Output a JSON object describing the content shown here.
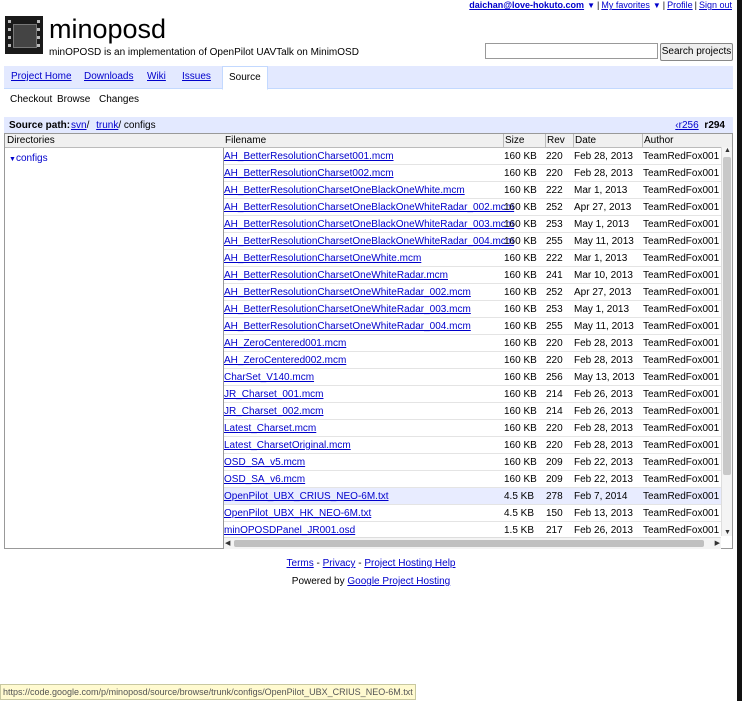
{
  "userbar": {
    "email": "daichan@love-hokuto.com",
    "favorites": "My favorites",
    "profile": "Profile",
    "signout": "Sign out"
  },
  "project": {
    "title": "minoposd",
    "summary": "minOPOSD is an implementation of OpenPilot UAVTalk on MinimOSD"
  },
  "search": {
    "button_label": "Search projects",
    "value": ""
  },
  "tabs": [
    "Project Home",
    "Downloads",
    "Wiki",
    "Issues",
    "Source"
  ],
  "active_tab": "Source",
  "subtabs": [
    "Checkout",
    "Browse",
    "Changes"
  ],
  "active_subtab": "Browse",
  "source_path": {
    "label": "Source path:",
    "segments": [
      "svn",
      "trunk",
      "configs"
    ],
    "prev_rev": "r256",
    "current_rev": "r294"
  },
  "directories": {
    "header": "Directories",
    "items": [
      "configs"
    ]
  },
  "table": {
    "columns": [
      "Filename",
      "Size",
      "Rev",
      "Date",
      "Author"
    ],
    "rows": [
      {
        "name": "AH_BetterResolutionCharset001.mcm",
        "size": "160 KB",
        "rev": "220",
        "date": "Feb 28, 2013",
        "author": "TeamRedFox001"
      },
      {
        "name": "AH_BetterResolutionCharset002.mcm",
        "size": "160 KB",
        "rev": "220",
        "date": "Feb 28, 2013",
        "author": "TeamRedFox001"
      },
      {
        "name": "AH_BetterResolutionCharsetOneBlackOneWhite.mcm",
        "size": "160 KB",
        "rev": "222",
        "date": "Mar 1, 2013",
        "author": "TeamRedFox001"
      },
      {
        "name": "AH_BetterResolutionCharsetOneBlackOneWhiteRadar_002.mcm",
        "size": "160 KB",
        "rev": "252",
        "date": "Apr 27, 2013",
        "author": "TeamRedFox001"
      },
      {
        "name": "AH_BetterResolutionCharsetOneBlackOneWhiteRadar_003.mcm",
        "size": "160 KB",
        "rev": "253",
        "date": "May 1, 2013",
        "author": "TeamRedFox001"
      },
      {
        "name": "AH_BetterResolutionCharsetOneBlackOneWhiteRadar_004.mcm",
        "size": "160 KB",
        "rev": "255",
        "date": "May 11, 2013",
        "author": "TeamRedFox001"
      },
      {
        "name": "AH_BetterResolutionCharsetOneWhite.mcm",
        "size": "160 KB",
        "rev": "222",
        "date": "Mar 1, 2013",
        "author": "TeamRedFox001"
      },
      {
        "name": "AH_BetterResolutionCharsetOneWhiteRadar.mcm",
        "size": "160 KB",
        "rev": "241",
        "date": "Mar 10, 2013",
        "author": "TeamRedFox001"
      },
      {
        "name": "AH_BetterResolutionCharsetOneWhiteRadar_002.mcm",
        "size": "160 KB",
        "rev": "252",
        "date": "Apr 27, 2013",
        "author": "TeamRedFox001"
      },
      {
        "name": "AH_BetterResolutionCharsetOneWhiteRadar_003.mcm",
        "size": "160 KB",
        "rev": "253",
        "date": "May 1, 2013",
        "author": "TeamRedFox001"
      },
      {
        "name": "AH_BetterResolutionCharsetOneWhiteRadar_004.mcm",
        "size": "160 KB",
        "rev": "255",
        "date": "May 11, 2013",
        "author": "TeamRedFox001"
      },
      {
        "name": "AH_ZeroCentered001.mcm",
        "size": "160 KB",
        "rev": "220",
        "date": "Feb 28, 2013",
        "author": "TeamRedFox001"
      },
      {
        "name": "AH_ZeroCentered002.mcm",
        "size": "160 KB",
        "rev": "220",
        "date": "Feb 28, 2013",
        "author": "TeamRedFox001"
      },
      {
        "name": "CharSet_V140.mcm",
        "size": "160 KB",
        "rev": "256",
        "date": "May 13, 2013",
        "author": "TeamRedFox001"
      },
      {
        "name": "JR_Charset_001.mcm",
        "size": "160 KB",
        "rev": "214",
        "date": "Feb 26, 2013",
        "author": "TeamRedFox001"
      },
      {
        "name": "JR_Charset_002.mcm",
        "size": "160 KB",
        "rev": "214",
        "date": "Feb 26, 2013",
        "author": "TeamRedFox001"
      },
      {
        "name": "Latest_Charset.mcm",
        "size": "160 KB",
        "rev": "220",
        "date": "Feb 28, 2013",
        "author": "TeamRedFox001"
      },
      {
        "name": "Latest_CharsetOriginal.mcm",
        "size": "160 KB",
        "rev": "220",
        "date": "Feb 28, 2013",
        "author": "TeamRedFox001"
      },
      {
        "name": "OSD_SA_v5.mcm",
        "size": "160 KB",
        "rev": "209",
        "date": "Feb 22, 2013",
        "author": "TeamRedFox001"
      },
      {
        "name": "OSD_SA_v6.mcm",
        "size": "160 KB",
        "rev": "209",
        "date": "Feb 22, 2013",
        "author": "TeamRedFox001"
      },
      {
        "name": "OpenPilot_UBX_CRIUS_NEO-6M.txt",
        "size": "4.5 KB",
        "rev": "278",
        "date": "Feb 7, 2014",
        "author": "TeamRedFox001"
      },
      {
        "name": "OpenPilot_UBX_HK_NEO-6M.txt",
        "size": "4.5 KB",
        "rev": "150",
        "date": "Feb 13, 2013",
        "author": "TeamRedFox001"
      },
      {
        "name": "minOPOSDPanel_JR001.osd",
        "size": "1.5 KB",
        "rev": "217",
        "date": "Feb 26, 2013",
        "author": "TeamRedFox001"
      }
    ],
    "highlighted_row": 20
  },
  "footer": {
    "terms": "Terms",
    "privacy": "Privacy",
    "help": "Project Hosting Help",
    "powered_prefix": "Powered by ",
    "powered_link": "Google Project Hosting"
  },
  "statusbar": {
    "url": "https://code.google.com/p/minoposd/source/browse/trunk/configs/OpenPilot_UBX_CRIUS_NEO-6M.txt"
  },
  "colors": {
    "link": "#0000cc",
    "tab_bar": "#e3e9ff",
    "highlight_row": "#e8ecff"
  }
}
